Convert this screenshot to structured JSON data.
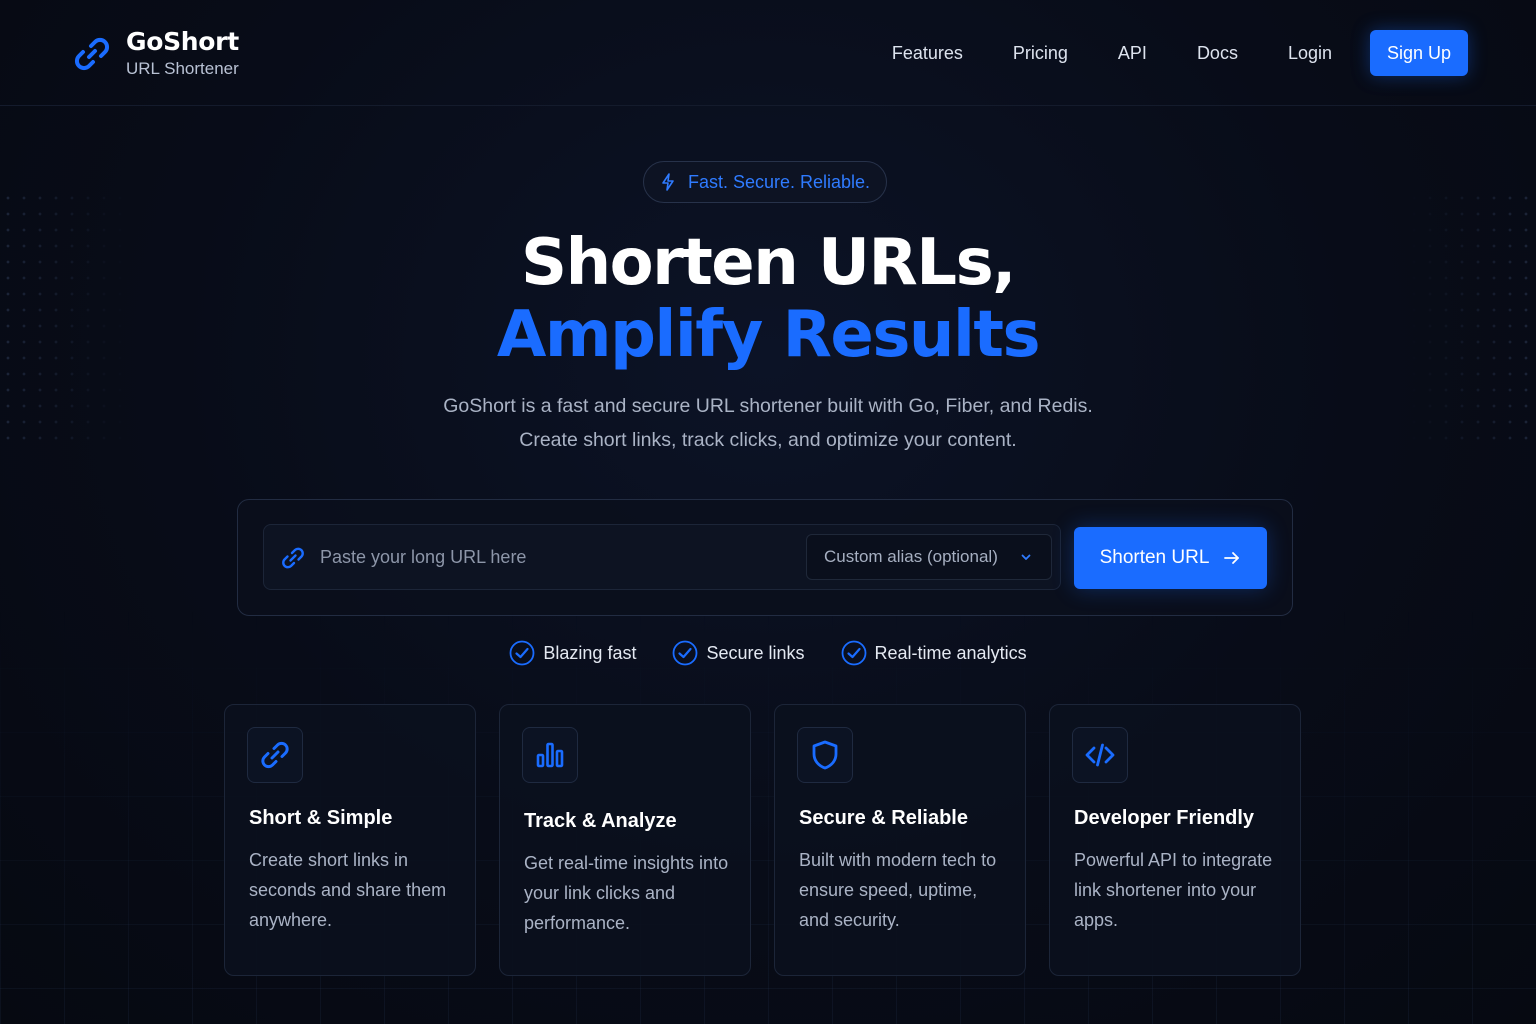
{
  "nav": {
    "brand_name": "GoShort",
    "brand_sub": "URL Shortener",
    "links": [
      "Features",
      "Pricing",
      "API",
      "Docs",
      "Login"
    ],
    "signup_label": "Sign Up"
  },
  "hero": {
    "badge": "Fast. Secure. Reliable.",
    "title_line1": "Shorten URLs,",
    "title_line2": "Amplify Results",
    "subtitle_line1": "GoShort is a fast and secure URL shortener built with Go, Fiber, and Redis.",
    "subtitle_line2": "Create short links, track clicks, and optimize your content."
  },
  "form": {
    "url_placeholder": "Paste your long URL here",
    "alias_placeholder": "Custom alias (optional)",
    "submit_label": "Shorten URL"
  },
  "checks": [
    "Blazing fast",
    "Secure links",
    "Real-time analytics"
  ],
  "features": [
    {
      "icon": "link-icon",
      "title": "Short & Simple",
      "desc": "Create short links in seconds and share them anywhere."
    },
    {
      "icon": "bar-chart-icon",
      "title": "Track & Analyze",
      "desc": "Get real-time insights into your link clicks and performance."
    },
    {
      "icon": "shield-icon",
      "title": "Secure & Reliable",
      "desc": "Built with modern tech to ensure speed, uptime, and security."
    },
    {
      "icon": "code-icon",
      "title": "Developer Friendly",
      "desc": "Powerful API to integrate link shortener into your apps."
    }
  ],
  "colors": {
    "accent": "#1a6cff",
    "background": "#070b16",
    "card_bg": "#0b101d",
    "text_muted": "#aab3c5"
  }
}
